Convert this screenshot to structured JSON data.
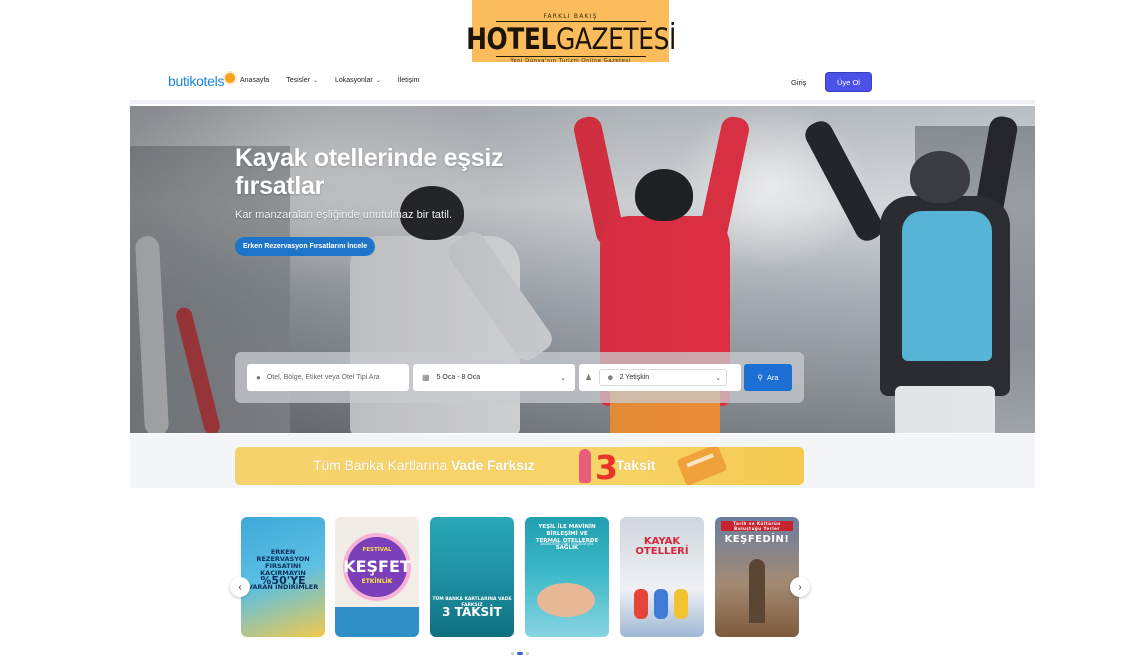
{
  "masthead": {
    "tagline_top": "FARKLI BAKIŞ",
    "brand_bold": "HOTEL",
    "brand_light": "GAZETESİ",
    "tagline_bottom": "Yeni Dünya'nın Turizm Online Gazetesi"
  },
  "nav": {
    "logo": "butikotels",
    "links": [
      {
        "label": "Anasayfa",
        "dropdown": false
      },
      {
        "label": "Tesisler",
        "dropdown": true
      },
      {
        "label": "Lokasyonlar",
        "dropdown": true
      },
      {
        "label": "İletişim",
        "dropdown": false
      }
    ],
    "login_label": "Giriş",
    "signup_label": "Üye Ol"
  },
  "hero": {
    "title": "Kayak otellerinde eşsiz fırsatlar",
    "subtitle": "Kar manzaraları eşliğinde unutulmaz bir tatil.",
    "cta_label": "Erken Rezervasyon Fırsatlarını İncele"
  },
  "search": {
    "location_placeholder": "Otel, Bölge, Etiket veya Otel Tipi Ara",
    "dates_value": "5 Oca - 8 Oca",
    "guests_value": "2 Yetişkin",
    "search_button": "Ara"
  },
  "promo": {
    "text_regular": "Tüm Banka Kartlarına ",
    "text_bold": "Vade Farksız",
    "number": "3",
    "text_end": "Taksit"
  },
  "carousel": {
    "cards": [
      {
        "name": "erken-rezervasyon",
        "lines": [
          "ERKEN",
          "REZERVASYON",
          "FIRSATINI",
          "KAÇIRMAYIN"
        ],
        "big": "%50'YE",
        "small": "VARAN İNDİRİMLER"
      },
      {
        "name": "festival-kesfet",
        "top": "FESTİVAL",
        "big": "KEŞFET",
        "bottom": "ETKİNLİK"
      },
      {
        "name": "taksit",
        "small": "TÜM BANKA KARTLARINA VADE FARKSIZ",
        "big": "3 TAKSİT"
      },
      {
        "name": "termal",
        "lines": [
          "YEŞİL İLE MAVİNİN BİRLEŞİMİ VE",
          "TERMAL OTELLERDE SAĞLIK"
        ],
        "sub": "butikotels.com fırsatlarıyla"
      },
      {
        "name": "kayak-otelleri",
        "big_1": "KAYAK",
        "big_2": "OTELLERİ"
      },
      {
        "name": "kesfedin",
        "tag": "Tarih ve Kültürün Buluştuğu Yerler",
        "big": "KEŞFEDİN!"
      }
    ]
  },
  "pagination": {
    "count": 3,
    "active": 1
  },
  "colors": {
    "accent": "#4a52e8",
    "primary_button": "#1d6fd3",
    "cta": "#1e74c9",
    "promo_yellow": "#f5d26b",
    "masthead_bg": "#fbbd5c"
  }
}
